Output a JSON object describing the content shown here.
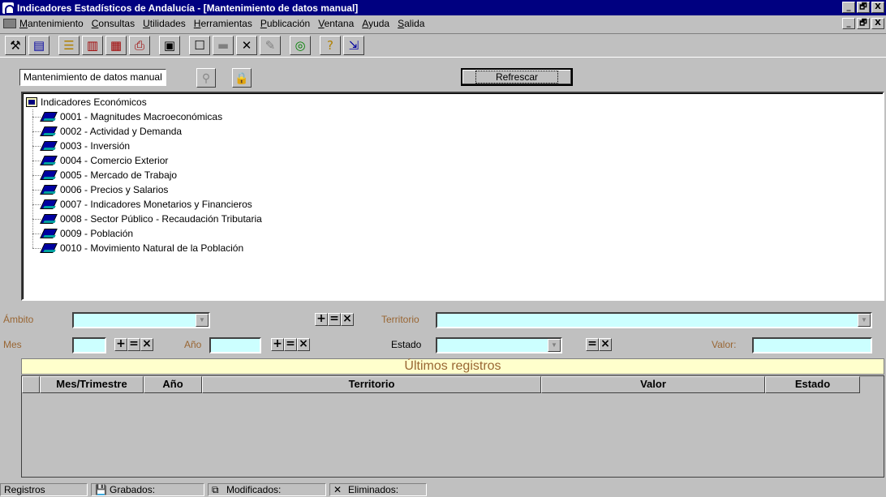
{
  "window": {
    "title": "Indicadores Estadísticos de Andalucía - [Mantenimiento de datos manual]",
    "btn_min": "_",
    "btn_restore": "🗗",
    "btn_close": "X"
  },
  "menu": {
    "items": [
      "Mantenimiento",
      "Consultas",
      "Utilidades",
      "Herramientas",
      "Publicación",
      "Ventana",
      "Ayuda",
      "Salida"
    ]
  },
  "toolbar": {
    "icons": [
      "tools-icon",
      "database-icon",
      "list-icon",
      "chart-icon",
      "table-icon",
      "print-icon",
      "calculator-icon",
      "new-document-icon",
      "save-icon",
      "delete-icon",
      "edit-icon",
      "globe-icon",
      "help-icon",
      "exit-icon"
    ]
  },
  "form": {
    "title": "Mantenimiento de datos manual",
    "refresh_label": "Refrescar"
  },
  "tree": {
    "root": "Indicadores Económicos",
    "items": [
      "0001 - Magnitudes Macroeconómicas",
      "0002 - Actividad y Demanda",
      "0003 - Inversión",
      "0004 - Comercio Exterior",
      "0005 - Mercado de Trabajo",
      "0006 - Precios y Salarios",
      "0007 - Indicadores Monetarios y Financieros",
      "0008 - Sector Público - Recaudación Tributaria",
      "0009 - Población",
      "0010 - Movimiento Natural de la Población"
    ]
  },
  "filters": {
    "ambito_label": "Ámbito",
    "territorio_label": "Territorio",
    "mes_label": "Mes",
    "anio_label": "Año",
    "estado_label": "Estado",
    "valor_label": "Valor:",
    "op_plus": "+",
    "op_eq": "=",
    "op_x": "×"
  },
  "grid": {
    "title": "Últimos registros",
    "columns": [
      "Mes/Trimestre",
      "Año",
      "Territorio",
      "Valor",
      "Estado"
    ]
  },
  "status": {
    "registros": "Registros",
    "grabados": "Grabados:",
    "modificados": "Modificados:",
    "eliminados": "Eliminados:"
  }
}
